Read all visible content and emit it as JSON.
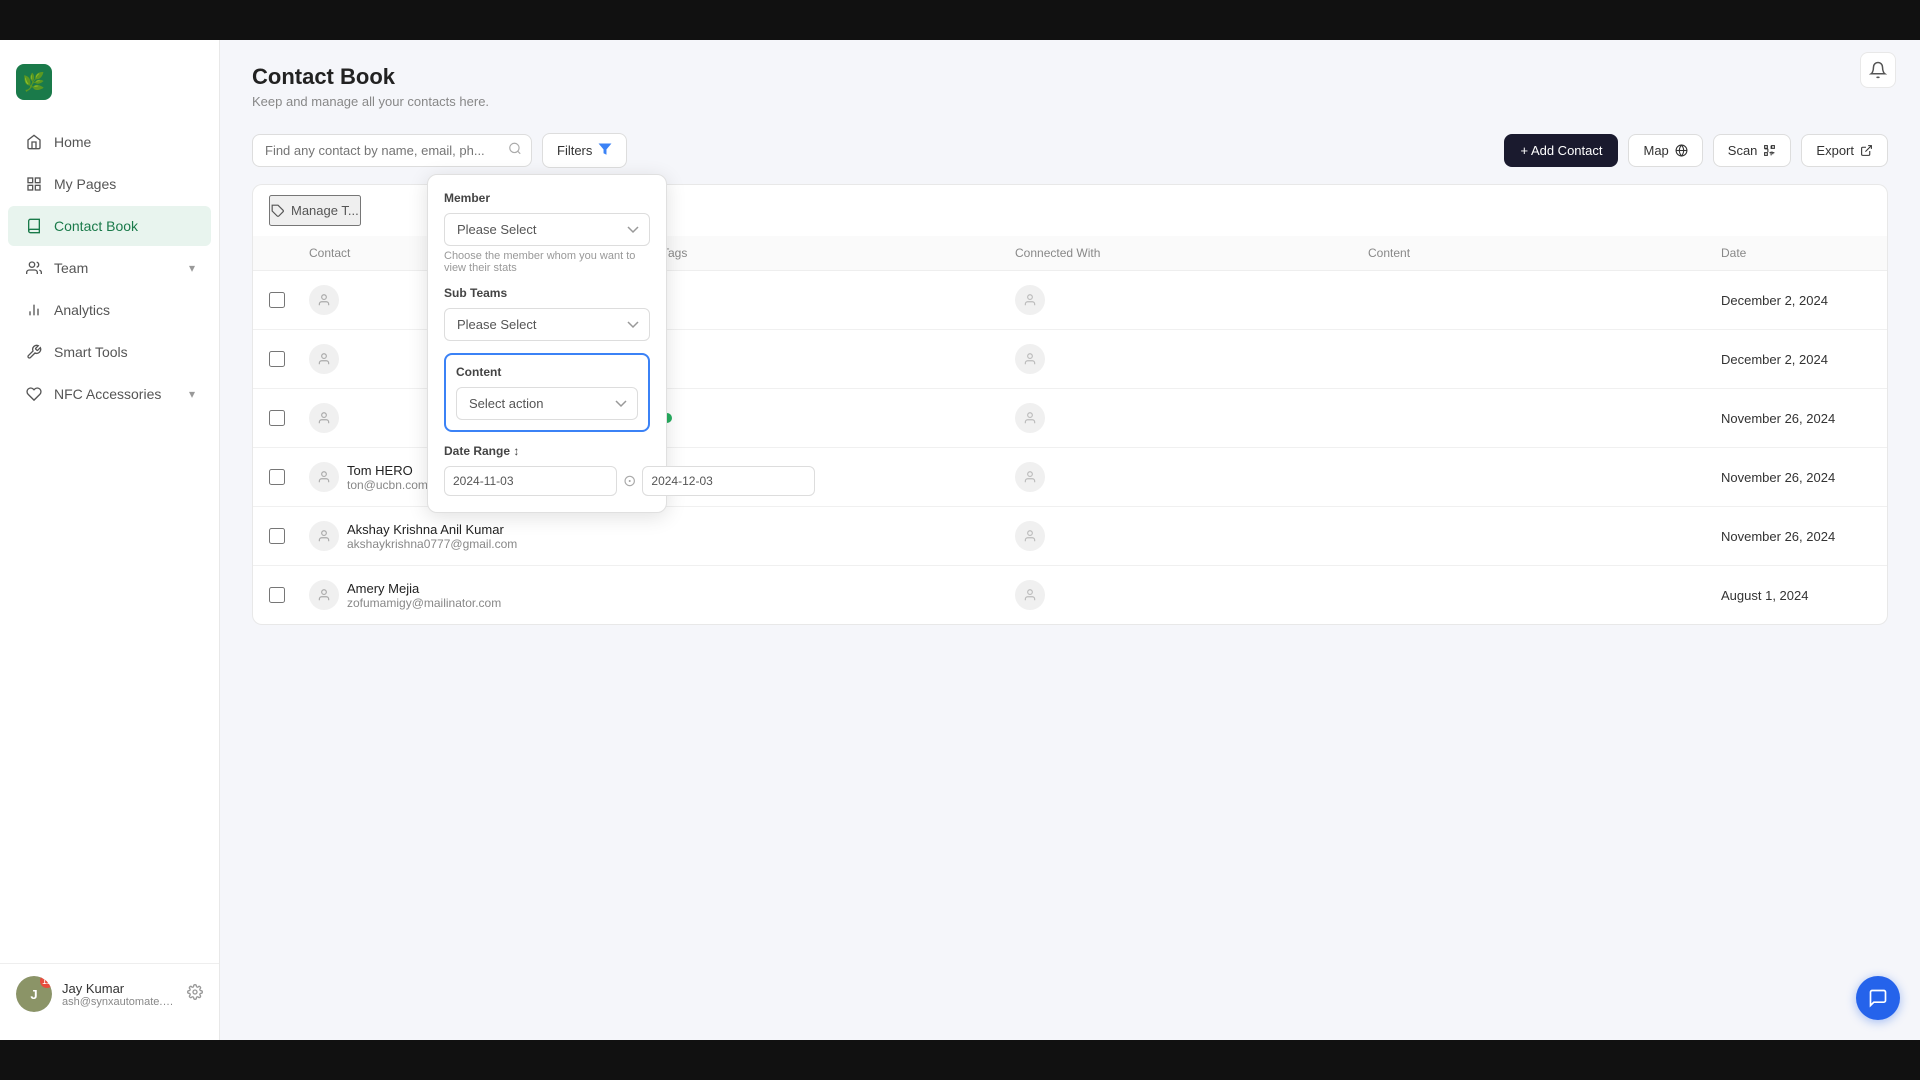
{
  "topBar": {},
  "sidebar": {
    "logo": "🌿",
    "nav": [
      {
        "id": "home",
        "label": "Home",
        "icon": "home",
        "active": false
      },
      {
        "id": "my-pages",
        "label": "My Pages",
        "icon": "pages",
        "active": false
      },
      {
        "id": "contact-book",
        "label": "Contact Book",
        "icon": "book",
        "active": true
      },
      {
        "id": "team",
        "label": "Team",
        "icon": "team",
        "active": false,
        "hasChevron": true
      },
      {
        "id": "analytics",
        "label": "Analytics",
        "icon": "analytics",
        "active": false
      },
      {
        "id": "smart-tools",
        "label": "Smart Tools",
        "icon": "tools",
        "active": false
      },
      {
        "id": "nfc-accessories",
        "label": "NFC Accessories",
        "icon": "nfc",
        "active": false,
        "hasChevron": true
      }
    ],
    "user": {
      "name": "Jay Kumar",
      "email": "ash@synxautomate.com",
      "badge": "12"
    }
  },
  "page": {
    "title": "Contact Book",
    "subtitle": "Keep and manage all your contacts here."
  },
  "toolbar": {
    "searchPlaceholder": "Find any contact by name, email, ph...",
    "filtersLabel": "Filters",
    "addContactLabel": "+ Add Contact",
    "mapLabel": "Map",
    "scanLabel": "Scan",
    "exportLabel": "Export"
  },
  "manageTags": {
    "label": "Manage T..."
  },
  "table": {
    "columns": [
      "",
      "Contact",
      "Tags",
      "Connected With",
      "Content",
      "Date"
    ],
    "rows": [
      {
        "id": 1,
        "name": "",
        "email": "",
        "tag": null,
        "connected": true,
        "content": "",
        "date": "December 2, 2024"
      },
      {
        "id": 2,
        "name": "",
        "email": "",
        "tag": null,
        "connected": true,
        "content": "",
        "date": "December 2, 2024"
      },
      {
        "id": 3,
        "name": "",
        "email": "",
        "tag": "green",
        "connected": true,
        "content": "",
        "date": "November 26, 2024"
      },
      {
        "id": 4,
        "name": "Tom HERO",
        "email": "ton@ucbn.com",
        "tag": "red",
        "connected": true,
        "content": "",
        "date": "November 26, 2024"
      },
      {
        "id": 5,
        "name": "Akshay Krishna Anil Kumar",
        "email": "akshaykrishna0777@gmail.com",
        "tag": null,
        "connected": true,
        "content": "",
        "date": "November 26, 2024"
      },
      {
        "id": 6,
        "name": "Amery Mejia",
        "email": "zofumamigy@mailinator.com",
        "tag": null,
        "connected": true,
        "content": "",
        "date": "August 1, 2024"
      }
    ]
  },
  "filterDropdown": {
    "memberLabel": "Member",
    "memberPlaceholder": "Please Select",
    "memberHint": "Choose the member whom you want to view their stats",
    "subTeamsLabel": "Sub Teams",
    "subTeamsPlaceholder": "Please Select",
    "contentLabel": "Content",
    "contentPlaceholder": "Select action",
    "dateRangeLabel": "Date Range ↕",
    "dateFrom": "2024-11-03",
    "dateTo": "2024-12-03"
  },
  "chatBtn": "💬"
}
